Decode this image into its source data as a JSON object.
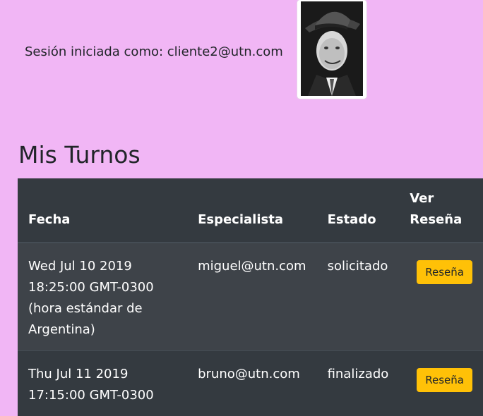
{
  "session": {
    "label": "Sesión iniciada como: cliente2@utn.com"
  },
  "page": {
    "title": "Mis Turnos"
  },
  "table": {
    "headers": {
      "fecha": "Fecha",
      "especialista": "Especialista",
      "estado": "Estado",
      "ver_resena_1": "Ver",
      "ver_resena_2": "Reseña"
    },
    "rows": [
      {
        "fecha": "Wed Jul 10 2019 18:25:00 GMT-0300 (hora estándar de Argentina)",
        "especialista": "miguel@utn.com",
        "estado": "solicitado",
        "button": "Reseña"
      },
      {
        "fecha": "Thu Jul 11 2019 17:15:00 GMT-0300",
        "especialista": "bruno@utn.com",
        "estado": "finalizado",
        "button": "Reseña"
      }
    ]
  },
  "colors": {
    "background": "#f1b6f5",
    "table_dark": "#343a40",
    "button_warning": "#ffc107"
  }
}
